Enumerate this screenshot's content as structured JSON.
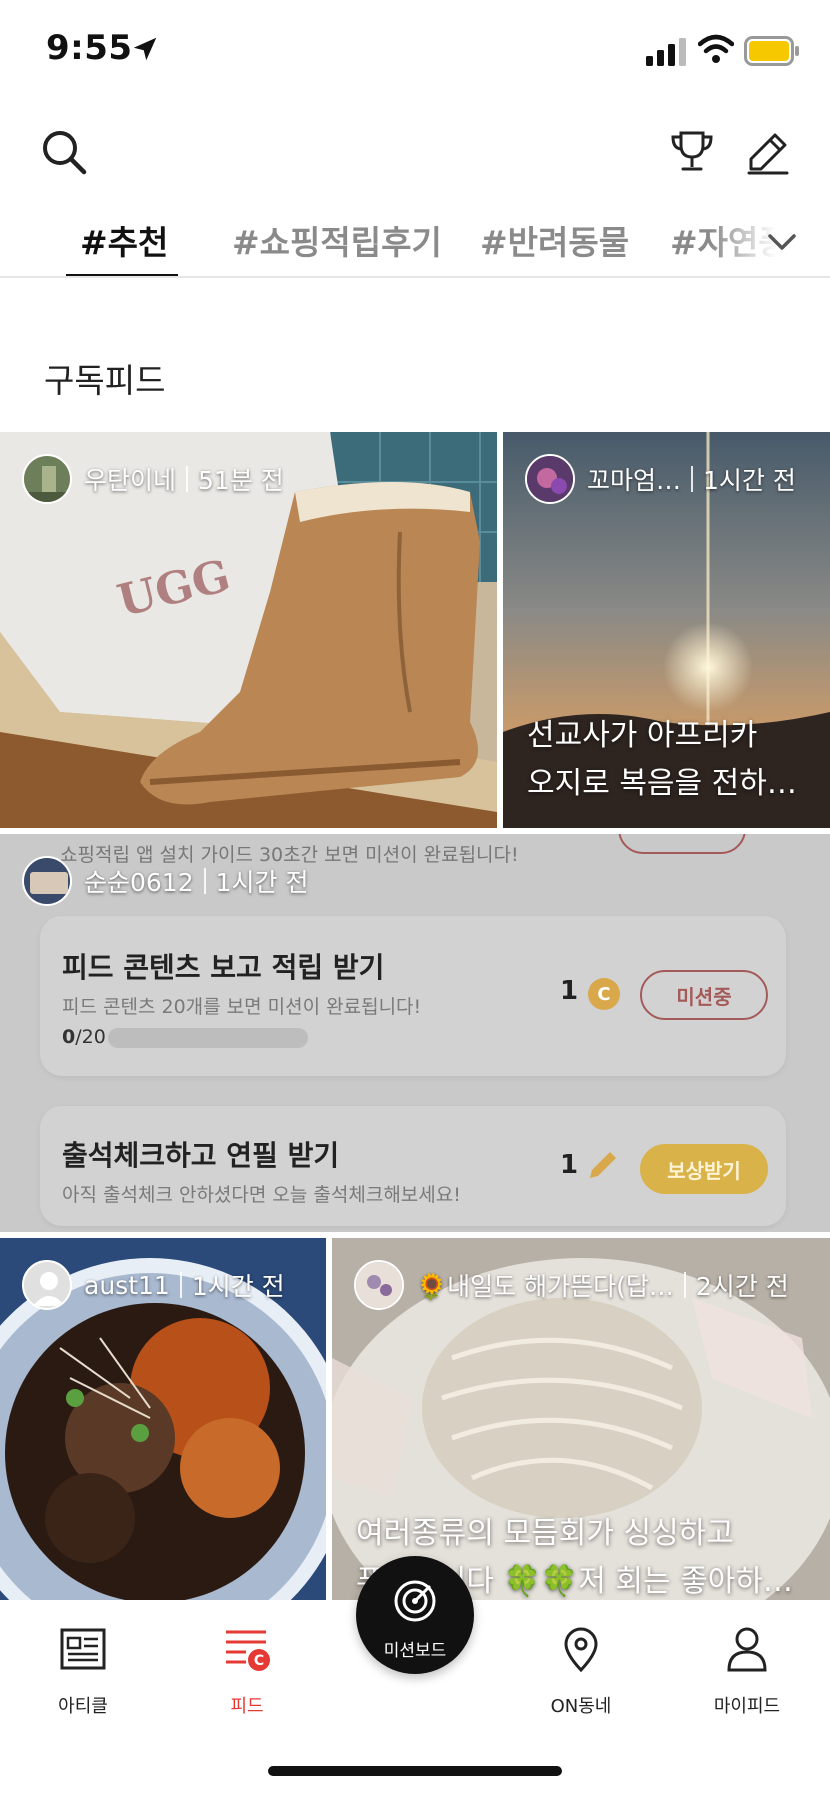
{
  "status_bar": {
    "time": "9:55"
  },
  "tabs": [
    {
      "label": "#추천"
    },
    {
      "label": "#쇼핑적립후기"
    },
    {
      "label": "#반려동물"
    },
    {
      "label": "#자연풍경"
    }
  ],
  "section_title": "구독피드",
  "posts": [
    {
      "author": "우탄이네",
      "time": "51분 전",
      "caption": ""
    },
    {
      "author": "꼬마엄…",
      "time": "1시간 전",
      "caption_line1": "선교사가 아프리카",
      "caption_line2": "오지로 복음을 전하…"
    },
    {
      "author": "순순0612",
      "time": "1시간 전",
      "mission": {
        "top_text": "쇼핑적립 앱 설치 가이드 30초간 보면 미션이 완료됩니다!",
        "item1_title": "피드 콘텐츠 보고 적립 받기",
        "item1_desc": "피드 콘텐츠 20개를 보면 미션이 완료됩니다!",
        "item1_progress_done": "0",
        "item1_progress_total": "/20",
        "item1_count": "1",
        "item1_coin": "C",
        "item1_button": "미션중",
        "item2_title": "출석체크하고 연필 받기",
        "item2_desc": "아직 출석체크 안하셨다면 오늘 출석체크해보세요!",
        "item2_count": "1",
        "item2_button": "보상받기"
      }
    },
    {
      "author": "aust11",
      "time": "1시간 전",
      "caption": ""
    },
    {
      "author": "🌻내일도 해가뜬다(답…",
      "time": "2시간 전",
      "caption_line1": "여러종류의 모듬회가 싱싱하고",
      "caption_line2": "푸짐합니다 🍀🍀저 회는 좋아하…"
    }
  ],
  "bottom_nav": {
    "article": "아티클",
    "feed": "피드",
    "mission": "미션보드",
    "neighborhood": "ON동네",
    "myfeed": "마이피드"
  },
  "colors": {
    "accent_red": "#e53935",
    "coin_gold": "#f2b705",
    "battery_yellow": "#f6c800"
  }
}
